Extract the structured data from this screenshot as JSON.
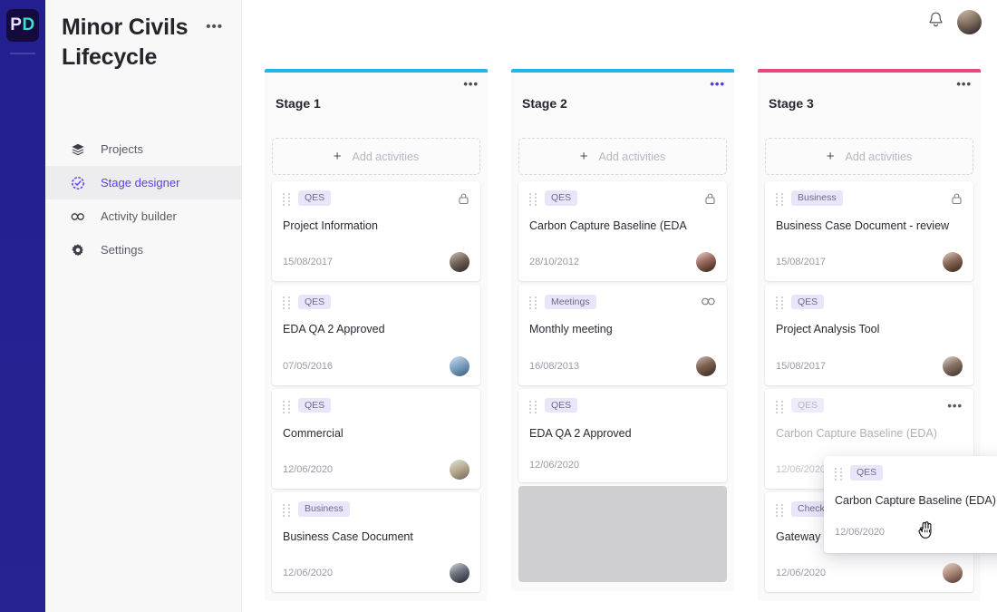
{
  "brand": {
    "logo_left": "P",
    "logo_right": "D",
    "accent": "#5b3cf0",
    "logo_bg": "#150a3d"
  },
  "sidebar": {
    "project_title": "Minor Civils Lifecycle",
    "menu_dots": "•••",
    "items": [
      {
        "label": "Projects",
        "icon": "layers-icon",
        "active": false
      },
      {
        "label": "Stage designer",
        "icon": "stage-clock-icon",
        "active": true
      },
      {
        "label": "Activity builder",
        "icon": "infinity-icon",
        "active": false
      },
      {
        "label": "Settings",
        "icon": "gear-icon",
        "active": false
      }
    ]
  },
  "topbar": {
    "bell": "notification-bell",
    "avatar": "user-avatar"
  },
  "board": {
    "add_activities_label": "Add activities",
    "add_plus": "+",
    "dots": "•••",
    "columns": [
      {
        "title": "Stage 1",
        "accent": "#1cb8e8",
        "dots_accent": false,
        "cards": [
          {
            "tag": "QES",
            "title": "Project Information",
            "date": "15/08/2017",
            "icon": "lock-icon",
            "avatar": "av1",
            "faded": false
          },
          {
            "tag": "QES",
            "title": "EDA QA 2 Approved",
            "date": "07/05/2016",
            "icon": "",
            "avatar": "av2",
            "faded": false
          },
          {
            "tag": "QES",
            "title": "Commercial",
            "date": "12/06/2020",
            "icon": "",
            "avatar": "av3",
            "faded": false
          },
          {
            "tag": "Business",
            "title": "Business Case Document",
            "date": "12/06/2020",
            "icon": "",
            "avatar": "av4",
            "faded": false
          }
        ]
      },
      {
        "title": "Stage 2",
        "accent": "#1cb8e8",
        "dots_accent": true,
        "cards": [
          {
            "tag": "QES",
            "title": "Carbon Capture Baseline (EDA",
            "date": "28/10/2012",
            "icon": "lock-icon",
            "avatar": "av5",
            "faded": false
          },
          {
            "tag": "Meetings",
            "title": "Monthly meeting",
            "date": "16/08/2013",
            "icon": "infinity-icon",
            "avatar": "av6",
            "faded": false
          },
          {
            "tag": "QES",
            "title": "EDA QA 2 Approved",
            "date": "12/06/2020",
            "icon": "",
            "avatar": "",
            "faded": false
          }
        ]
      },
      {
        "title": "Stage 3",
        "accent": "#e8467c",
        "dots_accent": false,
        "cards": [
          {
            "tag": "Business",
            "title": "Business Case Document - review",
            "date": "15/08/2017",
            "icon": "lock-icon",
            "avatar": "av7",
            "faded": false
          },
          {
            "tag": "QES",
            "title": "Project Analysis Tool",
            "date": "15/08/2017",
            "icon": "",
            "avatar": "av8",
            "faded": false
          },
          {
            "tag": "QES",
            "title": "Carbon Capture Baseline (EDA)",
            "date": "12/06/2020",
            "icon": "dots-icon",
            "avatar": "av9",
            "faded": true
          },
          {
            "tag": "Checklists",
            "title": "Gateway 1 Checklist",
            "date": "12/06/2020",
            "icon": "lock-icon",
            "avatar": "av10",
            "faded": false
          }
        ]
      }
    ]
  },
  "drag": {
    "card": {
      "tag": "QES",
      "title": "Carbon Capture Baseline (EDA)",
      "date": "12/06/2020",
      "icon": "dots-icon"
    },
    "cursor": "grabbing-hand-cursor"
  }
}
